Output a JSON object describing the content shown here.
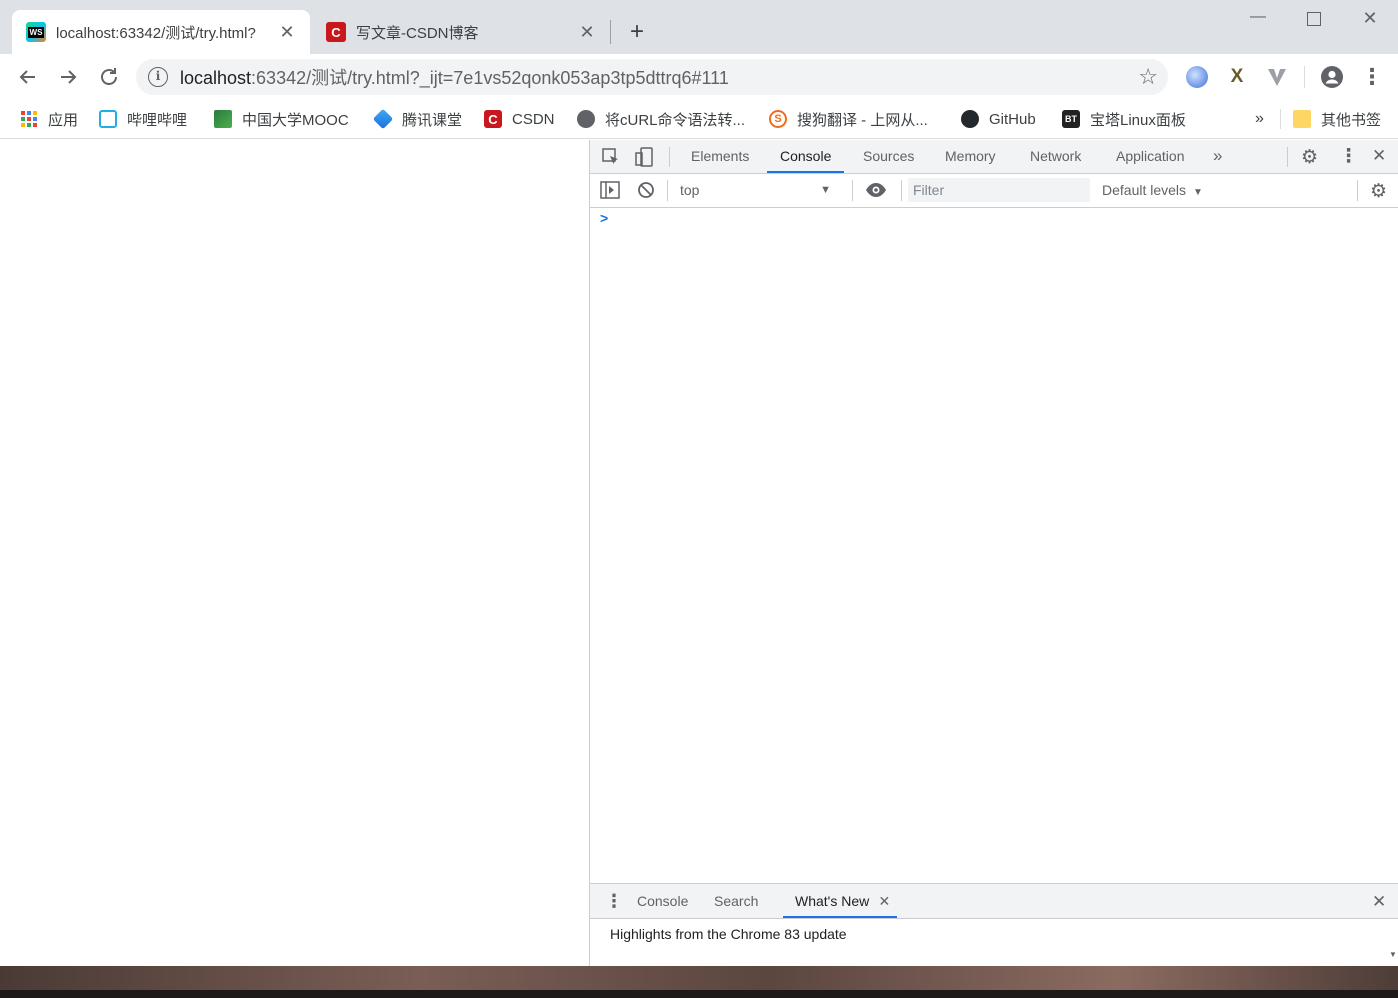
{
  "tabs": [
    {
      "title": "localhost:63342/测试/try.html?",
      "active": true,
      "icon": "webstorm-icon",
      "icon_text": "WS"
    },
    {
      "title": "写文章-CSDN博客",
      "active": false,
      "icon": "csdn-icon",
      "icon_text": "C"
    }
  ],
  "toolbar": {
    "url_host": "localhost",
    "url_rest": ":63342/测试/try.html?_ijt=7e1vs52qonk053ap3tp5dttrq6#111"
  },
  "bookmarks": [
    {
      "label": "应用",
      "icon": "apps-grid-icon"
    },
    {
      "label": "哔哩哔哩",
      "icon": "bilibili-icon"
    },
    {
      "label": "中国大学MOOC",
      "icon": "mooc-icon"
    },
    {
      "label": "腾讯课堂",
      "icon": "tencent-classroom-icon"
    },
    {
      "label": "CSDN",
      "icon": "csdn-icon"
    },
    {
      "label": "将cURL命令语法转...",
      "icon": "globe-icon"
    },
    {
      "label": "搜狗翻译 - 上网从...",
      "icon": "sogou-icon"
    },
    {
      "label": "GitHub",
      "icon": "github-icon"
    },
    {
      "label": "宝塔Linux面板",
      "icon": "bt-icon"
    },
    {
      "label": "其他书签",
      "icon": "folder-icon"
    }
  ],
  "bookmarks_overflow": "»",
  "devtools": {
    "tabs": [
      "Elements",
      "Console",
      "Sources",
      "Memory",
      "Network",
      "Application"
    ],
    "active_tab": "Console",
    "context": "top",
    "filter_placeholder": "Filter",
    "levels": "Default levels",
    "prompt": ">",
    "drawer_tabs": [
      "Console",
      "Search",
      "What's New"
    ],
    "drawer_active": "What's New",
    "drawer_message": "Highlights from the Chrome 83 update"
  },
  "colors": {
    "accent": "#1a73e8",
    "tabstrip": "#dee1e6",
    "csdn_red": "#c9171e"
  }
}
